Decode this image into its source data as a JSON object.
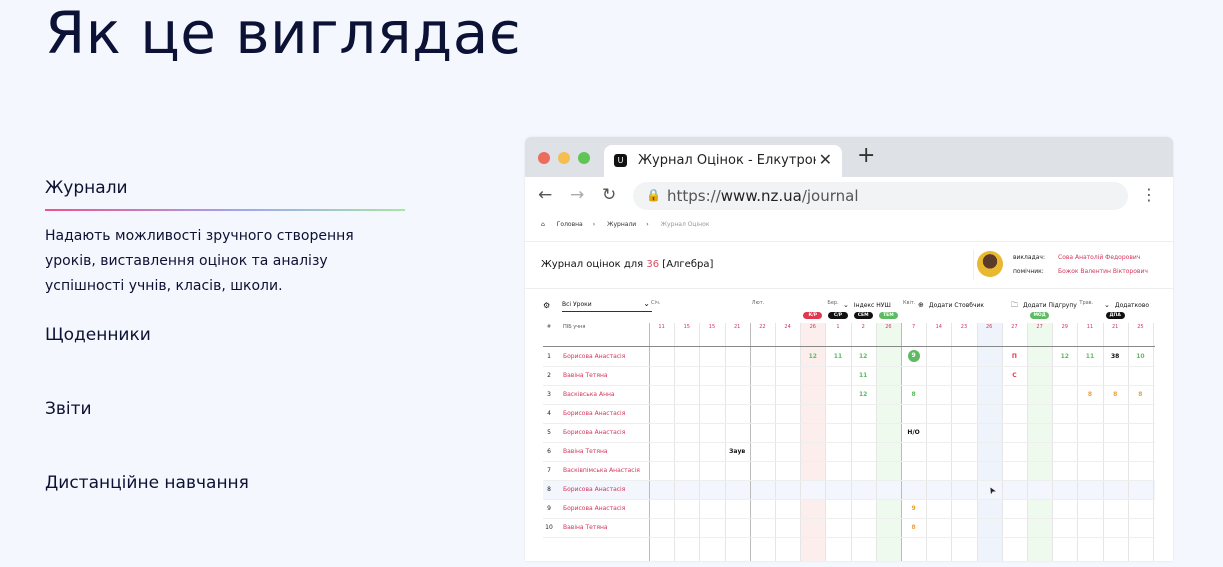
{
  "hero": {
    "title": "Як це виглядає"
  },
  "features": {
    "active": {
      "title": "Журнали",
      "description": "Надають можливості зручного створення уроків, виставлення оцінок та аналізу успішності учнів, класів, школи."
    },
    "items": [
      "Щоденники",
      "Звіти",
      "Дистанційне навчання"
    ],
    "underline_colors": [
      "#f0518a",
      "#9fa7f0",
      "#a6e6a1"
    ]
  },
  "browser": {
    "tab_title": "Журнал Оцінок - Елкутронний",
    "tab_icon": "nz-logo-icon",
    "url_prefix": "https://",
    "url_host": "www.nz.ua",
    "url_path": "/journal",
    "window_controls": {
      "close": "#ed6a5e",
      "minimize": "#f5bf4f",
      "maximize": "#61c554"
    }
  },
  "journal": {
    "breadcrumbs": [
      "Головна",
      "Журнали",
      "Журнал Оцінок"
    ],
    "title_prefix": "Журнал оцінок для",
    "class_num": "36",
    "subject": "[Алгебра]",
    "teacher_label": "викладач:",
    "teacher_name": "Сова Анатолій Федорович",
    "assistant_label": "помічник:",
    "assistant_name": "Божок Валентин Вікторович",
    "lesson_filter": "Всі Уроки",
    "toolbar": [
      {
        "icon": "chevron-down-icon",
        "label": "Індекс НУШ"
      },
      {
        "icon": "plus-circle-icon",
        "label": "Додати Стовбчик"
      },
      {
        "icon": "folder-icon",
        "label": "Додати Підгрупу"
      },
      {
        "icon": "chevron-down-icon",
        "label": "Додатково"
      }
    ],
    "header_num": "#",
    "header_name": "ПІБ учня",
    "months": [
      "Січ.",
      "Лют.",
      "Бер.",
      "Квіт.",
      "Трав."
    ],
    "days": [
      "11",
      "15",
      "15",
      "21",
      "22",
      "24",
      "26",
      "1",
      "2",
      "26",
      "7",
      "14",
      "23",
      "26",
      "27",
      "27",
      "29",
      "11",
      "21",
      "25"
    ],
    "badges": [
      {
        "label": "К/Р",
        "col": 6,
        "color": "#e0384e"
      },
      {
        "label": "С/Р",
        "col": 7,
        "color": "#111111"
      },
      {
        "label": "СЕМ",
        "col": 8,
        "color": "#111111"
      },
      {
        "label": "ТЕМ",
        "col": 9,
        "color": "#5dbb63"
      },
      {
        "label": "МОД",
        "col": 15,
        "color": "#5dbb63"
      },
      {
        "label": "ДПА",
        "col": 18,
        "color": "#111111"
      }
    ],
    "students": [
      {
        "num": "1",
        "name": "Борисова Анастасія"
      },
      {
        "num": "2",
        "name": "Вавіна Тетяна"
      },
      {
        "num": "3",
        "name": "Васківська Анна"
      },
      {
        "num": "4",
        "name": "Борисова Анастасія"
      },
      {
        "num": "5",
        "name": "Борисова Анастасія"
      },
      {
        "num": "6",
        "name": "Вавіна Тетяна"
      },
      {
        "num": "7",
        "name": "Васківпімська Анастасія"
      },
      {
        "num": "8",
        "name": "Борисова Анастасія"
      },
      {
        "num": "9",
        "name": "Борисова Анастасія"
      },
      {
        "num": "10",
        "name": "Вавіна Тетяна"
      }
    ],
    "grades": [
      {
        "row": 0,
        "col": 6,
        "v": "12",
        "c": "#5dbb63"
      },
      {
        "row": 0,
        "col": 7,
        "v": "11",
        "c": "#5dbb63"
      },
      {
        "row": 0,
        "col": 8,
        "v": "12",
        "c": "#5dbb63"
      },
      {
        "row": 0,
        "col": 10,
        "v": "9",
        "c": "#ffffff",
        "circle": "#5dbb63"
      },
      {
        "row": 0,
        "col": 14,
        "v": "П",
        "c": "#e0384e"
      },
      {
        "row": 0,
        "col": 16,
        "v": "12",
        "c": "#5dbb63"
      },
      {
        "row": 0,
        "col": 17,
        "v": "11",
        "c": "#5dbb63"
      },
      {
        "row": 0,
        "col": 18,
        "v": "38",
        "c": "#111111"
      },
      {
        "row": 0,
        "col": 19,
        "v": "10",
        "c": "#5dbb63"
      },
      {
        "row": 1,
        "col": 8,
        "v": "11",
        "c": "#5dbb63"
      },
      {
        "row": 1,
        "col": 14,
        "v": "С",
        "c": "#e0384e"
      },
      {
        "row": 2,
        "col": 8,
        "v": "12",
        "c": "#5dbb63"
      },
      {
        "row": 2,
        "col": 10,
        "v": "8",
        "c": "#5dbb63"
      },
      {
        "row": 2,
        "col": 17,
        "v": "8",
        "c": "#f0a040"
      },
      {
        "row": 2,
        "col": 18,
        "v": "8",
        "c": "#f0a040"
      },
      {
        "row": 2,
        "col": 19,
        "v": "8",
        "c": "#f0a040"
      },
      {
        "row": 4,
        "col": 10,
        "v": "Н/О",
        "c": "#111111"
      },
      {
        "row": 5,
        "col": 3,
        "v": "Заув",
        "c": "#111111"
      },
      {
        "row": 8,
        "col": 10,
        "v": "9",
        "c": "#e8a020"
      },
      {
        "row": 9,
        "col": 10,
        "v": "8",
        "c": "#f0a040"
      }
    ]
  }
}
